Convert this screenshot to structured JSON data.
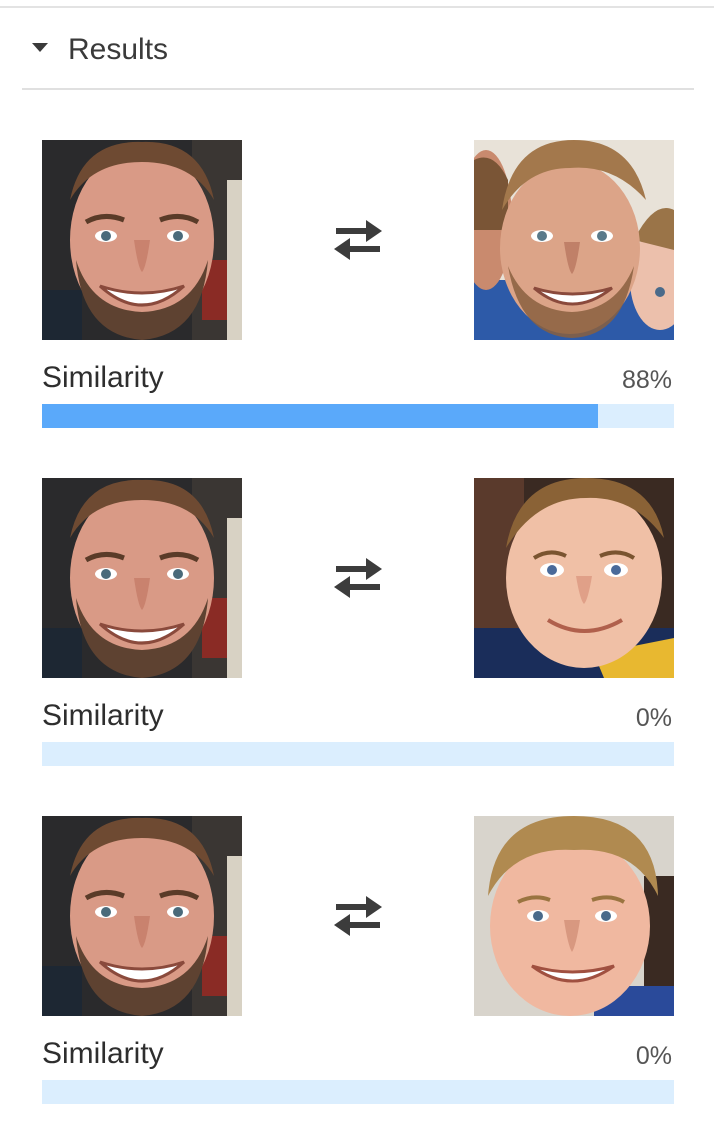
{
  "panel": {
    "section_title": "Results",
    "expanded": true,
    "colors": {
      "bar_track": "#dbeefe",
      "bar_fill": "#5aa9fa",
      "text": "#3a3a3a"
    }
  },
  "results": [
    {
      "source_image": "photo-adult-man-bearded-smiling",
      "match_image": "photo-adult-man-bearded-with-children",
      "swap_icon": "swap-arrows-icon",
      "similarity_label": "Similarity",
      "similarity_text": "88%",
      "similarity_fraction": 0.88
    },
    {
      "source_image": "photo-adult-man-bearded-smiling",
      "match_image": "photo-young-boy-smiling",
      "swap_icon": "swap-arrows-icon",
      "similarity_label": "Similarity",
      "similarity_text": "0%",
      "similarity_fraction": 0
    },
    {
      "source_image": "photo-adult-man-bearded-smiling",
      "match_image": "photo-young-boy-blond-smiling",
      "swap_icon": "swap-arrows-icon",
      "similarity_label": "Similarity",
      "similarity_text": "0%",
      "similarity_fraction": 0
    }
  ]
}
